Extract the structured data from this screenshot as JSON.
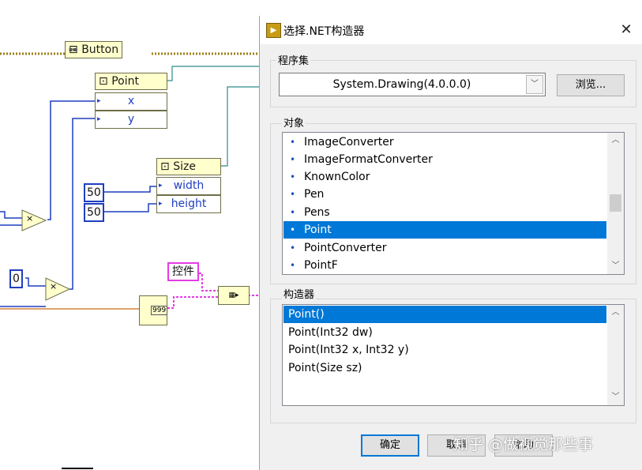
{
  "block_diagram": {
    "button_node": {
      "label": "Button"
    },
    "point_node": {
      "label": "Point",
      "props": [
        "x",
        "y"
      ]
    },
    "size_node": {
      "label": "Size",
      "props": [
        "width",
        "height"
      ]
    },
    "constants": {
      "width": "50",
      "height": "50",
      "zero": "0",
      "control": "控件"
    },
    "multiply_symbol": "×",
    "index_label": "999"
  },
  "dialog": {
    "title": "选择.NET构造器",
    "close_label": "✕",
    "assembly": {
      "label": "程序集",
      "value": "System.Drawing(4.0.0.0)",
      "browse_label": "浏览..."
    },
    "objects": {
      "label": "对象",
      "items": [
        "ImageConverter",
        "ImageFormatConverter",
        "KnownColor",
        "Pen",
        "Pens",
        "Point",
        "PointConverter",
        "PointF"
      ],
      "selected": "Point"
    },
    "constructors": {
      "label": "构造器",
      "items": [
        "Point()",
        "Point(Int32 dw)",
        "Point(Int32 x, Int32 y)",
        "Point(Size sz)"
      ],
      "selected": "Point()"
    },
    "ok_label": "确定",
    "cancel_label": "取消",
    "help_label": "帮助"
  },
  "watermark": "知乎 @做视觉那些事",
  "colors": {
    "accent": "#0078d7",
    "wire_blue": "#1f3fbf",
    "wire_pink": "#e43ce4",
    "node_fill": "#ffffcc"
  }
}
